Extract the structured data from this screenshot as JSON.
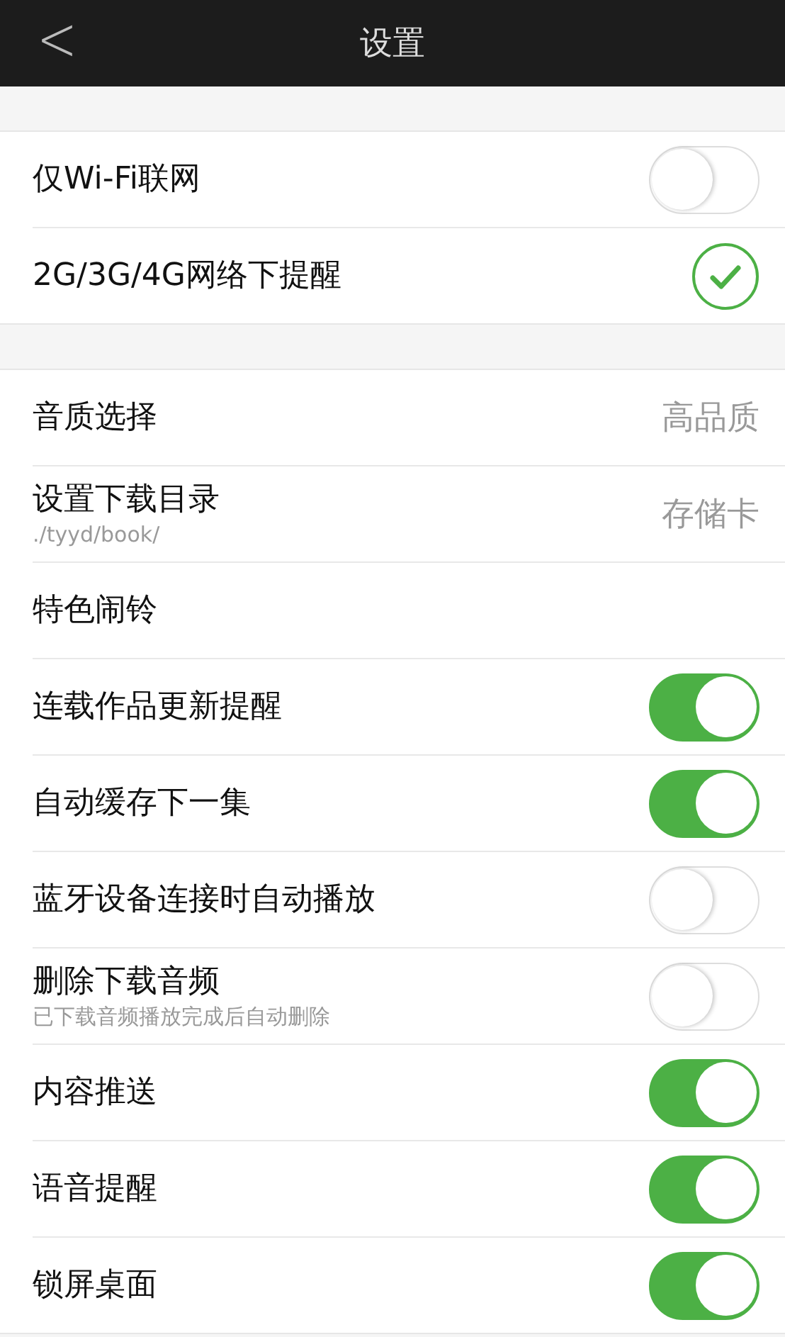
{
  "header": {
    "back": "<",
    "title": "设置"
  },
  "sections": [
    {
      "rows": [
        {
          "kind": "toggle",
          "label": "仅Wi-Fi联网",
          "on": false
        },
        {
          "kind": "check",
          "label": "2G/3G/4G网络下提醒",
          "checked": true
        }
      ]
    },
    {
      "rows": [
        {
          "kind": "value",
          "label": "音质选择",
          "value": "高品质"
        },
        {
          "kind": "value",
          "label": "设置下载目录",
          "sub": "./tyyd/book/",
          "value": "存储卡"
        },
        {
          "kind": "plain",
          "label": "特色闹铃"
        },
        {
          "kind": "toggle",
          "label": "连载作品更新提醒",
          "on": true
        },
        {
          "kind": "toggle",
          "label": "自动缓存下一集",
          "on": true
        },
        {
          "kind": "toggle",
          "label": "蓝牙设备连接时自动播放",
          "on": false
        },
        {
          "kind": "toggle",
          "label": "删除下载音频",
          "sub": "已下载音频播放完成后自动删除",
          "on": false
        },
        {
          "kind": "toggle",
          "label": "内容推送",
          "on": true
        },
        {
          "kind": "toggle",
          "label": "语音提醒",
          "on": true
        },
        {
          "kind": "toggle",
          "label": "锁屏桌面",
          "on": true
        }
      ]
    }
  ]
}
